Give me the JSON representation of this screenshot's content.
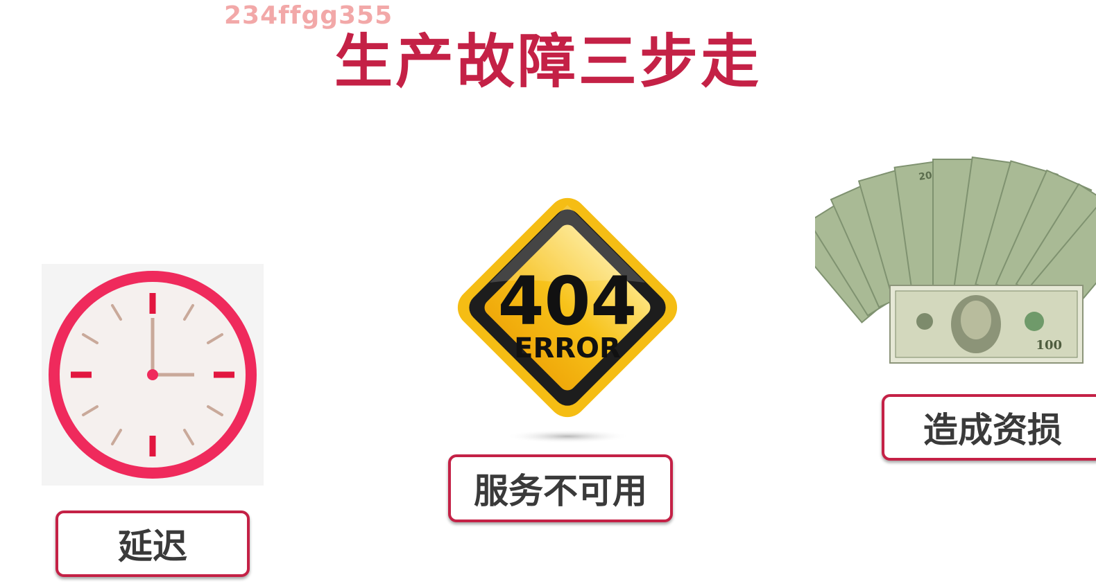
{
  "watermark": "234ffgg355",
  "title": "生产故障三步走",
  "items": [
    {
      "icon": "clock-icon",
      "label": "延迟"
    },
    {
      "icon": "error-404-sign-icon",
      "label": "服务不可用",
      "sign_number": "404",
      "sign_text": "ERROR"
    },
    {
      "icon": "money-stack-icon",
      "label": "造成资损",
      "bill_values": [
        "20",
        "100"
      ]
    }
  ],
  "colors": {
    "accent": "#c42146",
    "clock_ring": "#ef2a5c",
    "sign_yellow": "#f7c21a",
    "money_green": "#9fb28a"
  }
}
